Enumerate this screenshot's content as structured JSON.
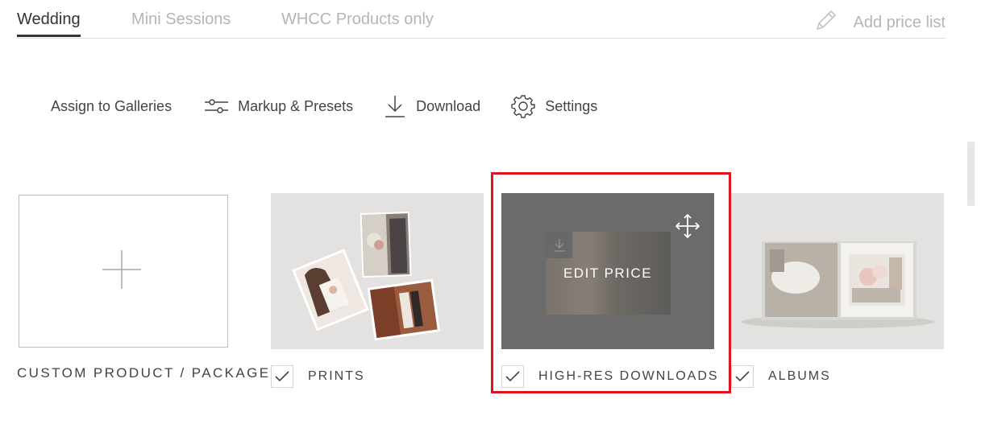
{
  "tabs": [
    {
      "label": "Wedding",
      "active": true
    },
    {
      "label": "Mini Sessions",
      "active": false
    },
    {
      "label": "WHCC Products only",
      "active": false
    }
  ],
  "add_price_list": {
    "label": "Add price list",
    "icon": "pencil-icon"
  },
  "toolbar": {
    "assign_label": "Assign to Galleries",
    "markup_label": "Markup & Presets",
    "markup_icon": "sliders-icon",
    "download_label": "Download",
    "download_icon": "download-icon",
    "settings_label": "Settings",
    "settings_icon": "gear-icon"
  },
  "products": [
    {
      "label": "CUSTOM PRODUCT / PACKAGE",
      "icon": "plus-icon"
    },
    {
      "label": "PRINTS",
      "checked": true
    },
    {
      "label": "HIGH-RES DOWNLOADS",
      "checked": true,
      "hover_label": "EDIT PRICE",
      "icon": "move-icon",
      "highlighted": true
    },
    {
      "label": "ALBUMS",
      "checked": true
    }
  ],
  "colors": {
    "highlight": "#e0141e",
    "active_tab": "#333333",
    "inactive_tab": "#b5b5b5",
    "card_bg": "#e3e2e0",
    "hover_overlay": "#6b6b6b"
  }
}
